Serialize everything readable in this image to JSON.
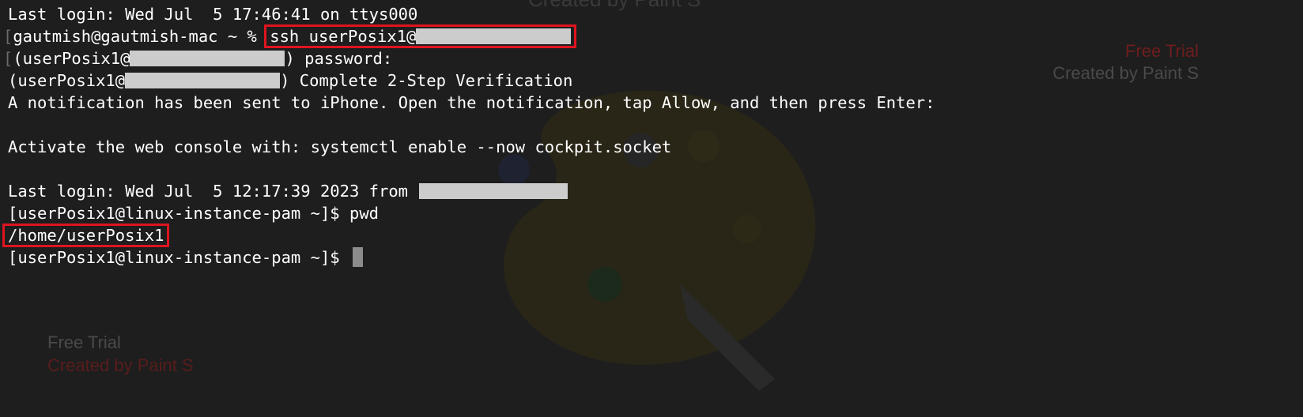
{
  "terminal": {
    "lines": {
      "l1": "Last login: Wed Jul  5 17:46:41 on ttys000",
      "l2_prompt": "gautmish@gautmish-mac ~ % ",
      "l2_cmd": "ssh userPosix1@",
      "l3_prefix": "(userPosix1@",
      "l3_suffix": ") password:",
      "l4_prefix": "(userPosix1@",
      "l4_suffix": ") Complete 2-Step Verification",
      "l5": "A notification has been sent to iPhone. Open the notification, tap Allow, and then press Enter:",
      "l7": "Activate the web console with: systemctl enable --now cockpit.socket",
      "l9_prefix": "Last login: Wed Jul  5 12:17:39 2023 from ",
      "l10_prompt": "[userPosix1@linux-instance-pam ~]$ ",
      "l10_cmd": "pwd",
      "l11_output": "/home/userPosix1",
      "l12_prompt": "[userPosix1@linux-instance-pam ~]$ "
    },
    "bracket_marker": "["
  },
  "watermark": {
    "top": "Created by Paint S",
    "free_trial_right": "Free Trial",
    "created_right": "Created by Paint S",
    "free_trial_left": "Free Trial",
    "created_left": "Created by Paint S",
    "icon": "paint-palette-icon"
  },
  "colors": {
    "background": "#1e1e1e",
    "text": "#ffffff",
    "highlight_box": "#e0141e",
    "redaction": "#cccccc",
    "cursor": "#8c8c8c"
  }
}
